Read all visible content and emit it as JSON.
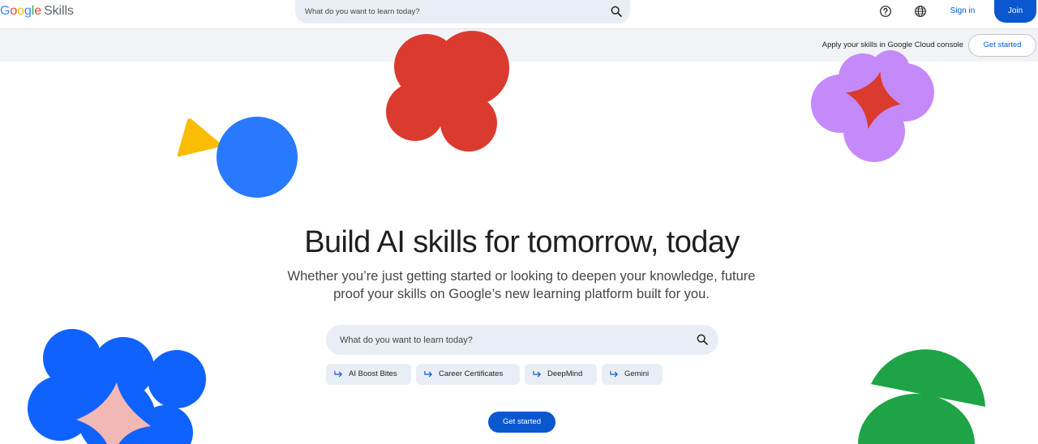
{
  "header": {
    "logo": {
      "google": [
        "G",
        "o",
        "o",
        "g",
        "l",
        "e"
      ],
      "product": "Skills"
    },
    "search_placeholder": "What do you want to learn today?",
    "signin_label": "Sign in",
    "join_label": "Join"
  },
  "banner": {
    "text": "Apply your skills in Google Cloud console",
    "button_label": "Get started"
  },
  "hero": {
    "title": "Build AI skills for tomorrow, today",
    "subtitle": "Whether you’re just getting started or looking to deepen your knowledge, future proof your skills on Google’s new learning platform built for you.",
    "search_placeholder": "What do you want to learn today?",
    "chips": [
      "AI Boost Bites",
      "Career Certificates",
      "DeepMind",
      "Gemini"
    ],
    "cta_label": "Get started"
  },
  "icons": {
    "search": "search-icon",
    "help": "help-icon",
    "language": "globe-icon",
    "chip_arrow": "redirect-arrow-icon"
  },
  "colors": {
    "accent": "#0b57d0",
    "search_bg": "#e9eef6",
    "banner_bg": "#f1f3f6",
    "google_blue": "#4285f4",
    "google_red": "#ea4335",
    "google_yellow": "#fbbc04",
    "google_green": "#34a853",
    "shape_red": "#db3a2f",
    "shape_blue": "#2979ff",
    "shape_purple": "#c58af9",
    "shape_pink": "#f2b8b5",
    "shape_green": "#1ea446",
    "shape_yellow": "#fbbc04"
  }
}
